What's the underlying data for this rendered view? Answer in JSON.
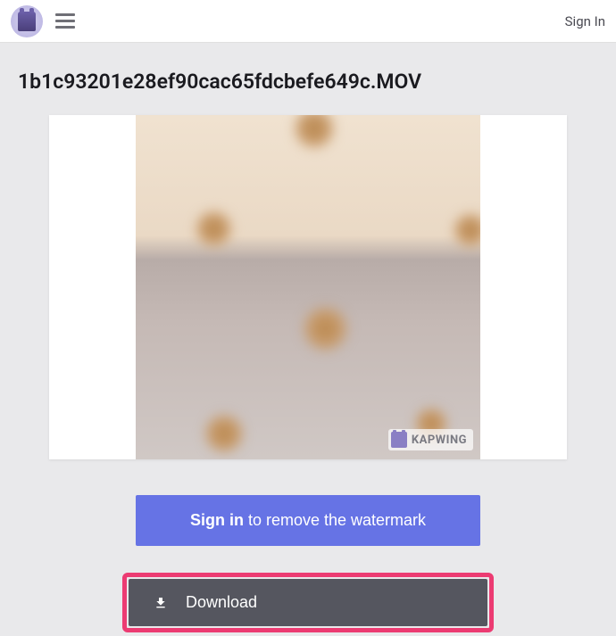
{
  "header": {
    "sign_in": "Sign In"
  },
  "page": {
    "title": "1b1c93201e28ef90cac65fdcbefe649c.MOV"
  },
  "watermark": {
    "brand": "KAPWING"
  },
  "buttons": {
    "signin_bold": "Sign in",
    "signin_rest": " to remove the watermark",
    "download": "Download"
  },
  "colors": {
    "primary_button": "#6673e5",
    "download_button": "#55565f",
    "highlight_border": "#ec3b72",
    "background": "#e9e9eb"
  }
}
